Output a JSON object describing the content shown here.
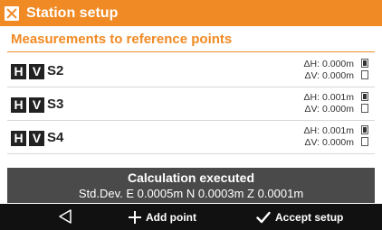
{
  "window": {
    "title": "Station setup",
    "icon": "app-logo-icon"
  },
  "section": {
    "heading": "Measurements to reference points"
  },
  "points": [
    {
      "h_badge": "H",
      "v_badge": "V",
      "name": "S2",
      "dh": "ΔH: 0.000m",
      "dv": "ΔV: 0.000m",
      "h_checked": true,
      "v_checked": false
    },
    {
      "h_badge": "H",
      "v_badge": "V",
      "name": "S3",
      "dh": "ΔH: 0.001m",
      "dv": "ΔV: 0.000m",
      "h_checked": true,
      "v_checked": false
    },
    {
      "h_badge": "H",
      "v_badge": "V",
      "name": "S4",
      "dh": "ΔH: 0.001m",
      "dv": "ΔV: 0.000m",
      "h_checked": true,
      "v_checked": false
    }
  ],
  "calculation": {
    "title": "Calculation executed",
    "std_dev": "Std.Dev. E 0.0005m N 0.0003m Z 0.0001m"
  },
  "bottom_bar": {
    "back_icon": "back-triangle-icon",
    "add_label": "Add point",
    "add_icon": "plus-icon",
    "accept_label": "Accept setup",
    "accept_icon": "check-icon"
  },
  "colors": {
    "accent": "#f08a24",
    "banner": "#4a4a4a",
    "bottom_bar": "#111111"
  }
}
